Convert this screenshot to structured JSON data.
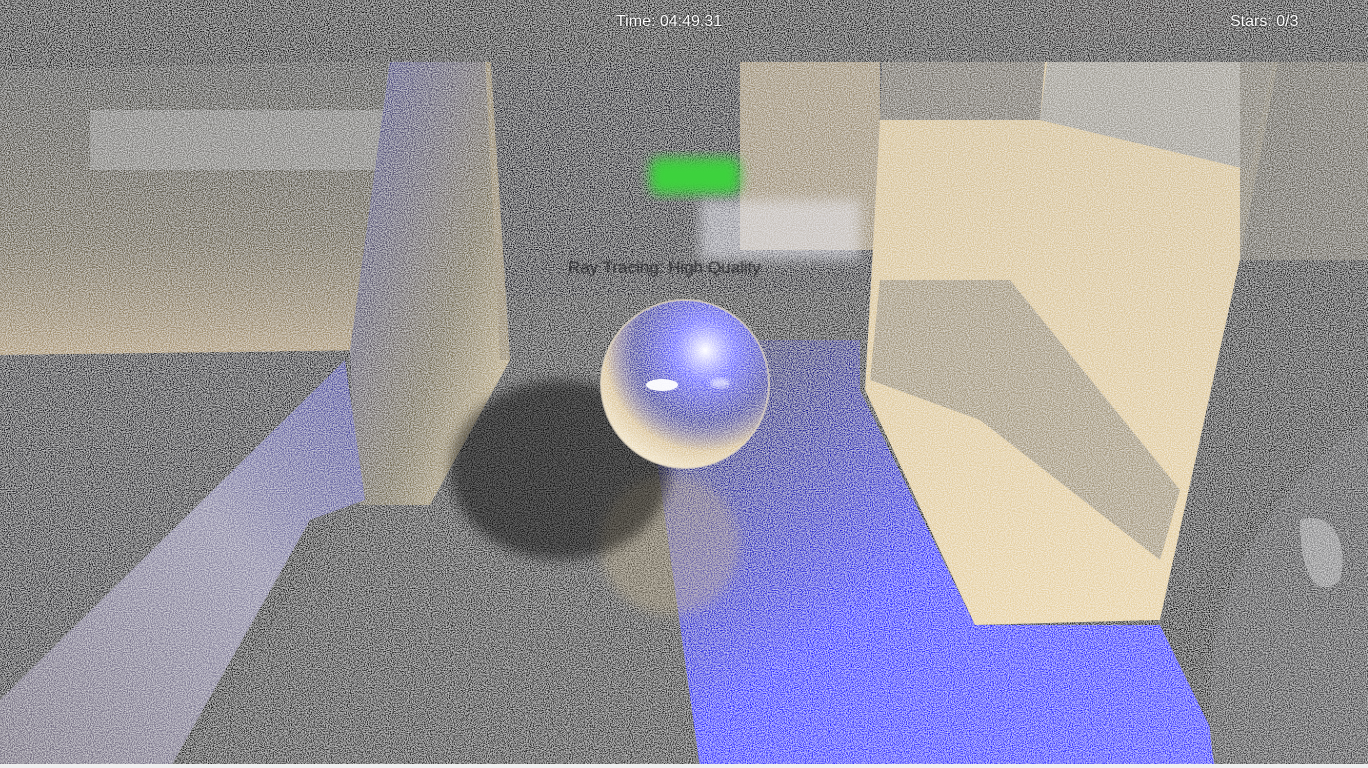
{
  "hud": {
    "timer_label": "Time:",
    "timer_value": "04:49.31",
    "stars_label": "Stars:",
    "stars_value": "0/3"
  },
  "overlay": {
    "render_mode_text": "Ray Tracing: High Quality"
  },
  "colors": {
    "floor_glow": "#1a1aff",
    "wall_sand": "#e8d2a0",
    "goal_green": "#3cd23c",
    "sky": "#000000"
  },
  "objects": {
    "player": "glass-ball",
    "goal": "green-marker"
  }
}
